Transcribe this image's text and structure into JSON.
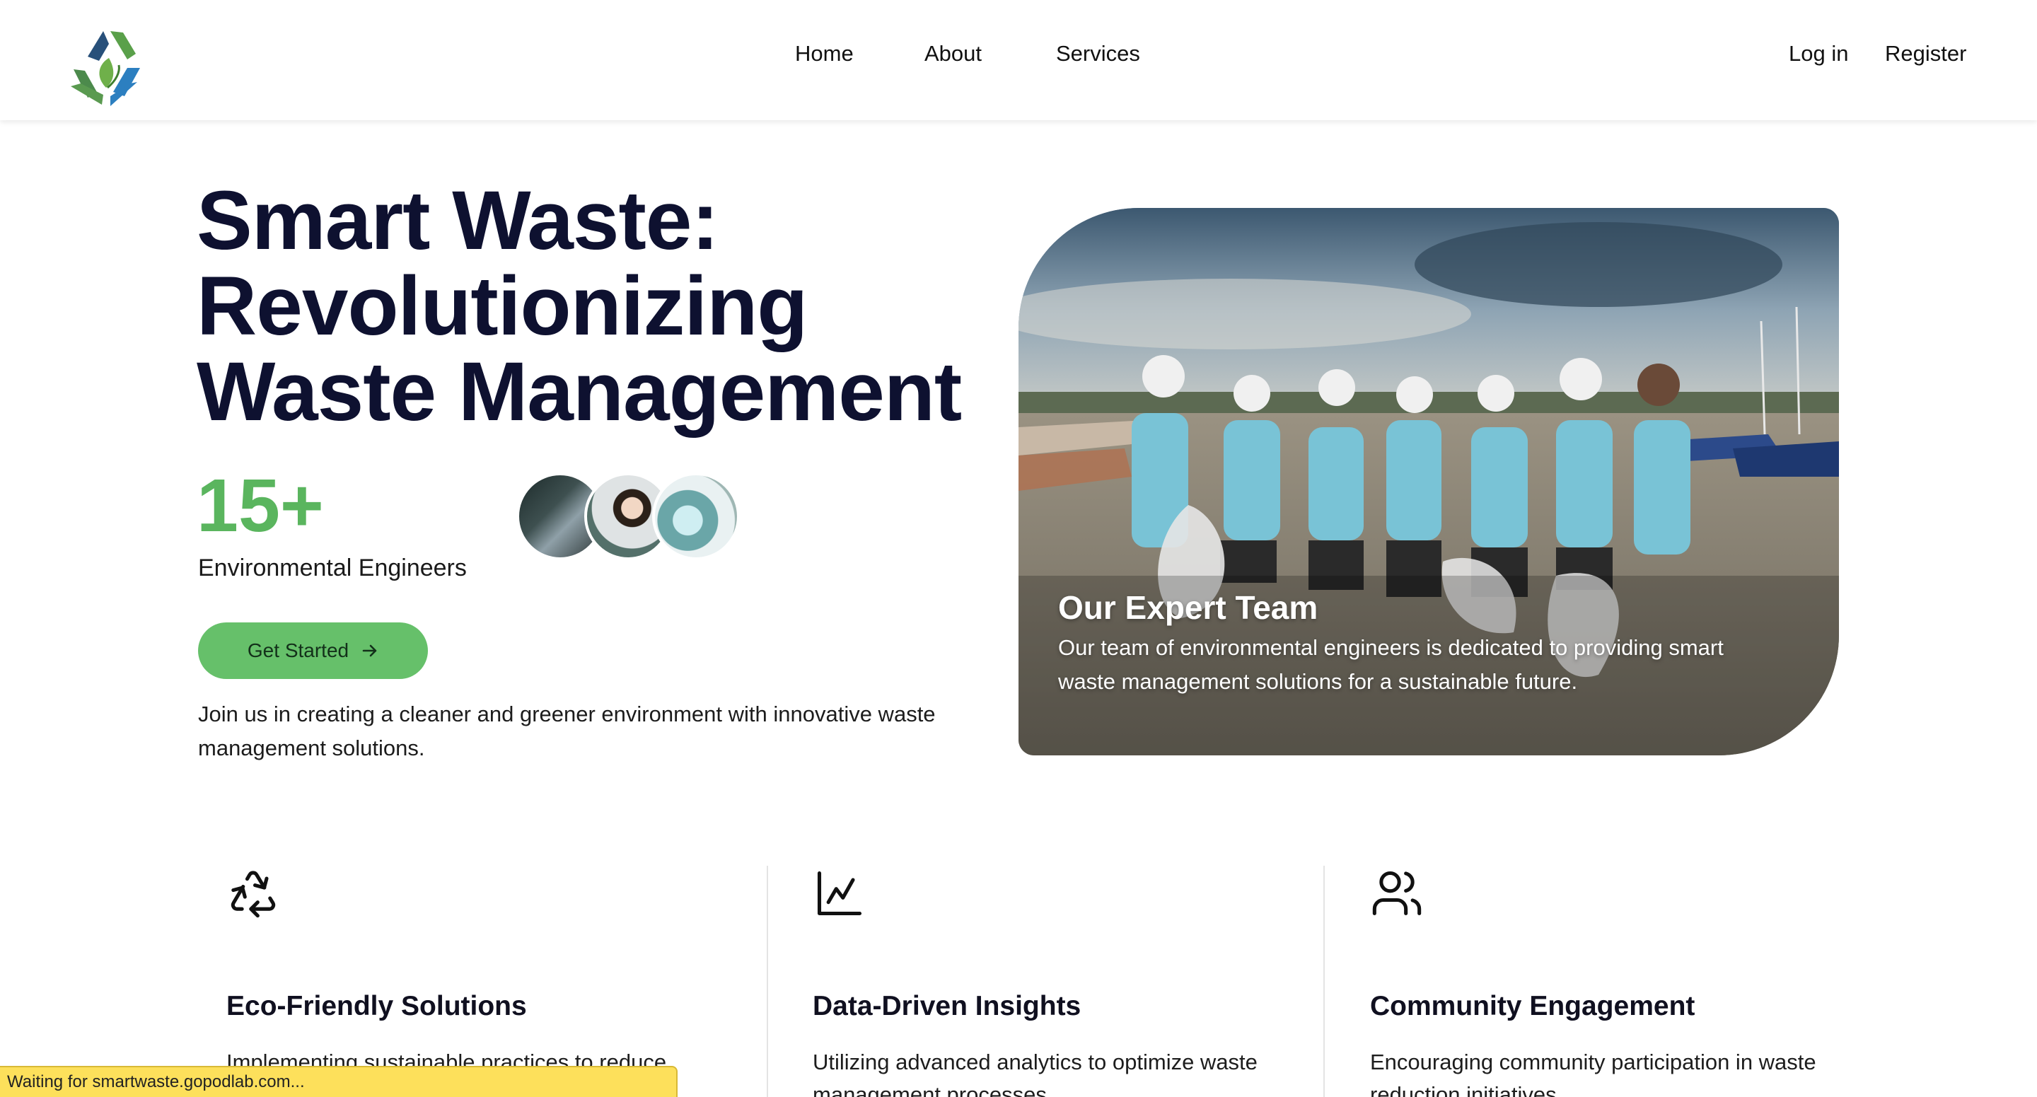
{
  "header": {
    "logo_icon": "recycle-leaf-logo",
    "nav": {
      "home": "Home",
      "about": "About",
      "services": "Services"
    },
    "auth": {
      "login": "Log in",
      "register": "Register"
    }
  },
  "hero": {
    "title": "Smart Waste: Revolutionizing Waste Management",
    "stat_number": "15+",
    "stat_label": "Environmental Engineers",
    "cta_label": "Get Started",
    "description": "Join us in creating a cleaner and greener environment with innovative waste management solutions.",
    "card": {
      "title": "Our Expert Team",
      "text": "Our team of environmental engineers is dedicated to providing smart waste management solutions for a sustainable future."
    }
  },
  "features": [
    {
      "icon": "recycle-icon",
      "title": "Eco-Friendly Solutions",
      "text": "Implementing sustainable practices to reduce"
    },
    {
      "icon": "line-chart-icon",
      "title": "Data-Driven Insights",
      "text": "Utilizing advanced analytics to optimize waste management processes."
    },
    {
      "icon": "users-icon",
      "title": "Community Engagement",
      "text": "Encouraging community participation in waste reduction initiatives."
    }
  ],
  "status_bar": {
    "text": "Waiting for smartwaste.gopodlab.com..."
  },
  "colors": {
    "accent_green": "#5ab55e",
    "button_green": "#66c06a",
    "status_yellow": "#fde05b"
  }
}
